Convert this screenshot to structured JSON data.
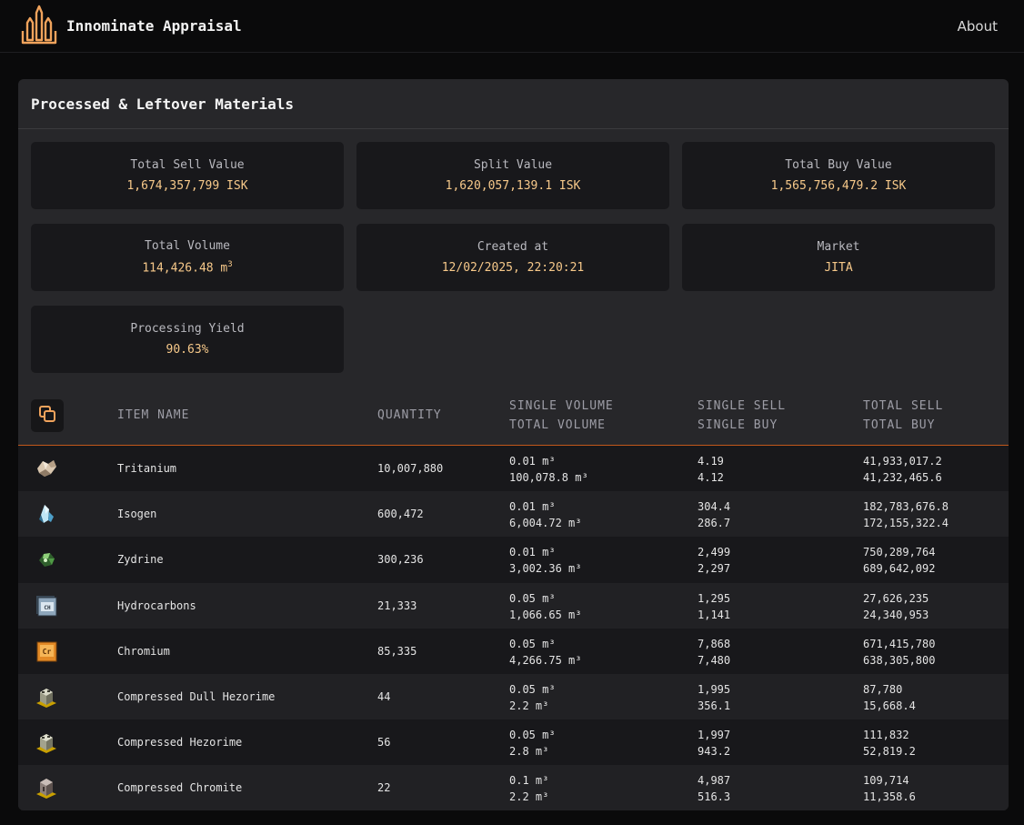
{
  "app": {
    "title": "Innominate Appraisal",
    "nav_about": "About"
  },
  "panel": {
    "title": "Processed & Leftover Materials"
  },
  "stats": [
    {
      "label": "Total Sell Value",
      "value": "1,674,357,799 ISK"
    },
    {
      "label": "Split Value",
      "value": "1,620,057,139.1 ISK"
    },
    {
      "label": "Total Buy Value",
      "value": "1,565,756,479.2 ISK"
    },
    {
      "label": "Total Volume",
      "value": "114,426.48 m",
      "value_sup": "3"
    },
    {
      "label": "Created at",
      "value": "12/02/2025, 22:20:21"
    },
    {
      "label": "Market",
      "value": "JITA"
    },
    {
      "label": "Processing Yield",
      "value": "90.63%"
    }
  ],
  "table": {
    "headers": {
      "item_name": "ITEM NAME",
      "quantity": "QUANTITY",
      "single_volume": "SINGLE VOLUME",
      "total_volume": "TOTAL VOLUME",
      "single_sell": "SINGLE SELL",
      "single_buy": "SINGLE BUY",
      "total_sell": "TOTAL SELL",
      "total_buy": "TOTAL BUY"
    },
    "rows": [
      {
        "icon": "tritanium-icon",
        "name": "Tritanium",
        "quantity": "10,007,880",
        "single_volume": "0.01 m³",
        "total_volume": "100,078.8 m³",
        "single_sell": "4.19",
        "single_buy": "4.12",
        "total_sell": "41,933,017.2",
        "total_buy": "41,232,465.6"
      },
      {
        "icon": "isogen-icon",
        "name": "Isogen",
        "quantity": "600,472",
        "single_volume": "0.01 m³",
        "total_volume": "6,004.72 m³",
        "single_sell": "304.4",
        "single_buy": "286.7",
        "total_sell": "182,783,676.8",
        "total_buy": "172,155,322.4"
      },
      {
        "icon": "zydrine-icon",
        "name": "Zydrine",
        "quantity": "300,236",
        "single_volume": "0.01 m³",
        "total_volume": "3,002.36 m³",
        "single_sell": "2,499",
        "single_buy": "2,297",
        "total_sell": "750,289,764",
        "total_buy": "689,642,092"
      },
      {
        "icon": "hydrocarbons-icon",
        "name": "Hydrocarbons",
        "quantity": "21,333",
        "single_volume": "0.05 m³",
        "total_volume": "1,066.65 m³",
        "single_sell": "1,295",
        "single_buy": "1,141",
        "total_sell": "27,626,235",
        "total_buy": "24,340,953"
      },
      {
        "icon": "chromium-icon",
        "name": "Chromium",
        "quantity": "85,335",
        "single_volume": "0.05 m³",
        "total_volume": "4,266.75 m³",
        "single_sell": "7,868",
        "single_buy": "7,480",
        "total_sell": "671,415,780",
        "total_buy": "638,305,800"
      },
      {
        "icon": "compressed-ore-icon",
        "name": "Compressed Dull Hezorime",
        "quantity": "44",
        "single_volume": "0.05 m³",
        "total_volume": "2.2 m³",
        "single_sell": "1,995",
        "single_buy": "356.1",
        "total_sell": "87,780",
        "total_buy": "15,668.4"
      },
      {
        "icon": "compressed-ore-icon",
        "name": "Compressed Hezorime",
        "quantity": "56",
        "single_volume": "0.05 m³",
        "total_volume": "2.8 m³",
        "single_sell": "1,997",
        "single_buy": "943.2",
        "total_sell": "111,832",
        "total_buy": "52,819.2"
      },
      {
        "icon": "compressed-chromite-icon",
        "name": "Compressed Chromite",
        "quantity": "22",
        "single_volume": "0.1 m³",
        "total_volume": "2.2 m³",
        "single_sell": "4,987",
        "single_buy": "516.3",
        "total_sell": "109,714",
        "total_buy": "11,358.6"
      }
    ]
  },
  "colors": {
    "accent": "#f7c98a",
    "divider": "#c2571b",
    "logo": "#f0a35c"
  }
}
